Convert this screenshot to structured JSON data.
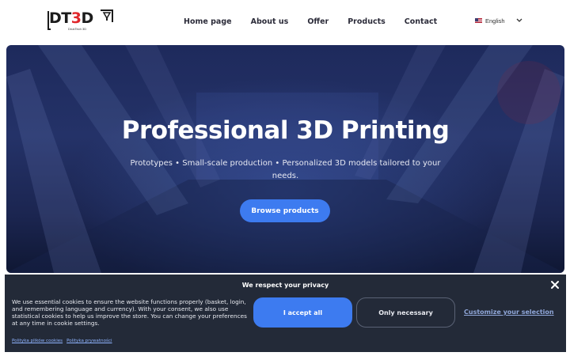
{
  "header": {
    "logo": {
      "text_dark": "DT",
      "text_red": "3",
      "text_dark2": "D",
      "subtitle": "DrukTech 3D"
    },
    "nav": [
      {
        "label": "Home page"
      },
      {
        "label": "About us"
      },
      {
        "label": "Offer"
      },
      {
        "label": "Products"
      },
      {
        "label": "Contact"
      }
    ],
    "language": {
      "label": "English",
      "flag": "us-flag-icon"
    }
  },
  "hero": {
    "title": "Professional 3D Printing",
    "subtitle": "Prototypes • Small-scale production • Personalized 3D models tailored to your needs.",
    "cta_label": "Browse products"
  },
  "cookie_banner": {
    "title": "We respect your privacy",
    "text": "We use essential cookies to ensure the website functions properly (basket, login, and remembering language and currency). With your consent, we also use statistical cookies to help us improve the store. You can change your preferences at any time in cookie settings.",
    "accept_label": "I accept all",
    "necessary_label": "Only necessary",
    "customize_label": "Customize your selection",
    "links": [
      {
        "label": "Polityka plików cookies"
      },
      {
        "label": "Polityka prywatności"
      }
    ]
  },
  "colors": {
    "accent": "#3d7bf0",
    "logo_red": "#e0262a",
    "banner_bg": "#232a38"
  }
}
